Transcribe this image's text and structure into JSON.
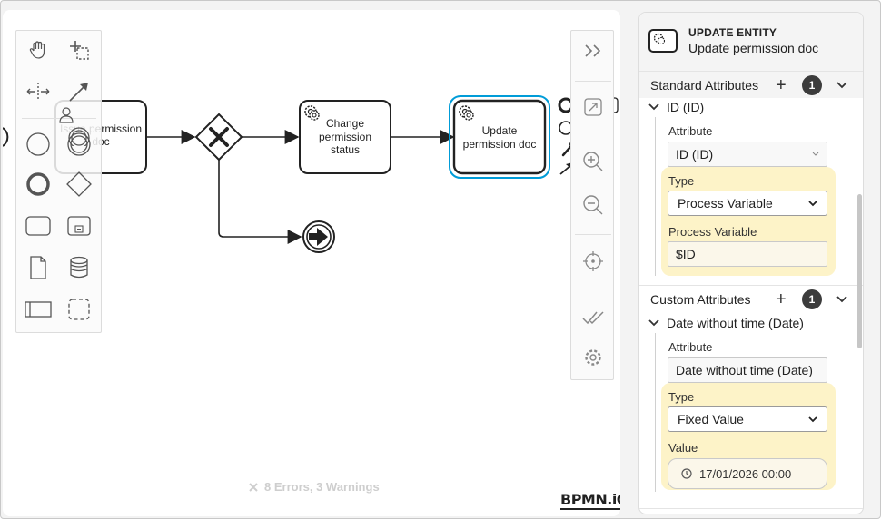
{
  "diagram": {
    "task_issue": "Issue permission doc",
    "task_change_line1": "Change",
    "task_change_line2": "permission",
    "task_change_line3": "status",
    "task_update_line1": "Update",
    "task_update_line2": "permission doc"
  },
  "status": {
    "errors_text": "8 Errors, 3 Warnings",
    "watermark": "BPMN.iO"
  },
  "panel": {
    "type_label": "UPDATE ENTITY",
    "element_name": "Update permission doc",
    "standard": {
      "title": "Standard Attributes",
      "count": "1",
      "item_title": "ID (ID)",
      "attribute_label": "Attribute",
      "attribute_value": "ID (ID)",
      "type_label": "Type",
      "type_value": "Process Variable",
      "pv_label": "Process Variable",
      "pv_value": "$ID"
    },
    "custom": {
      "title": "Custom Attributes",
      "count": "1",
      "item_title": "Date without time (Date)",
      "attribute_label": "Attribute",
      "attribute_value": "Date without time (Date)",
      "type_label": "Type",
      "type_value": "Fixed Value",
      "value_label": "Value",
      "value_value": "17/01/2026 00:00"
    }
  },
  "colors": {
    "accent": "#009cd8",
    "highlight": "#fdf3c8",
    "badge": "#3c3c3c"
  }
}
